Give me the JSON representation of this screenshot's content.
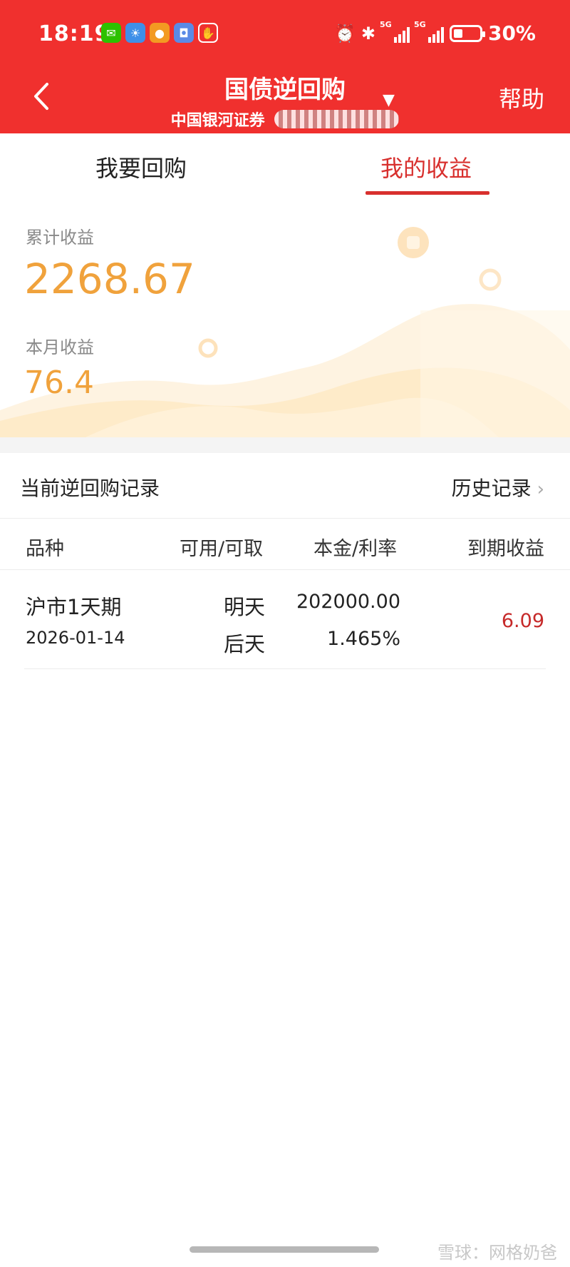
{
  "status_bar": {
    "time": "18:19",
    "network_1": "5G",
    "network_2": "5G",
    "battery": "30%",
    "notification_icons": [
      "wechat-icon",
      "weather-icon",
      "chat-icon",
      "app-icon",
      "hand-icon"
    ]
  },
  "header": {
    "title": "国债逆回购",
    "subtitle": "中国银河证券",
    "help": "帮助",
    "background_color": "#f0302e"
  },
  "tabs": [
    {
      "label": "我要回购",
      "active": false
    },
    {
      "label": "我的收益",
      "active": true
    }
  ],
  "earnings": {
    "total_label": "累计收益",
    "total_value": "2268.67",
    "month_label": "本月收益",
    "month_value": "76.4",
    "value_color": "#f0a23c"
  },
  "records": {
    "title": "当前逆回购记录",
    "history_link": "历史记录"
  },
  "table": {
    "headers": [
      "品种",
      "可用/可取",
      "本金/利率",
      "到期收益"
    ],
    "rows": [
      {
        "name": "沪市1天期",
        "date": "2026-01-14",
        "available": "明天",
        "withdrawable": "后天",
        "principal": "202000.00",
        "rate": "1.465%",
        "income": "6.09"
      }
    ]
  },
  "watermark": "雪球：网格奶爸"
}
